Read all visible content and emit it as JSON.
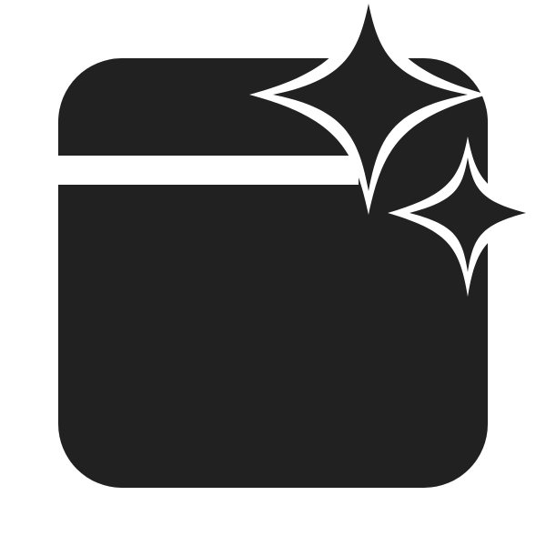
{
  "icon": {
    "name": "app-window-sparkle-icon",
    "fill_color": "#212121",
    "background_color": "#ffffff"
  }
}
